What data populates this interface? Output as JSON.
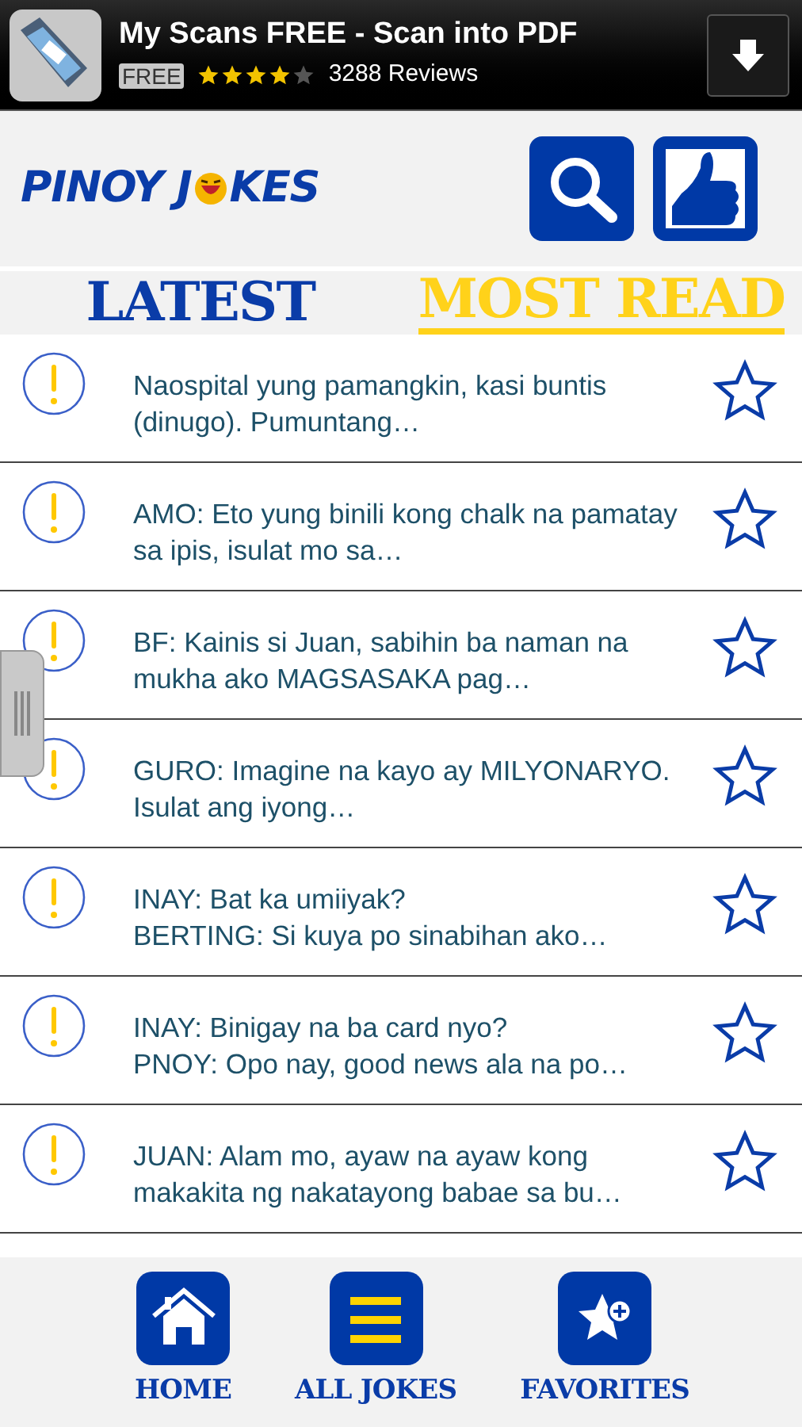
{
  "ad": {
    "title": "My Scans FREE - Scan into PDF",
    "price": "FREE",
    "stars": 4,
    "reviews": "3288 Reviews"
  },
  "logo": {
    "before": "PINOY J",
    "after": "KES"
  },
  "tabs": [
    {
      "label": "LATEST",
      "selected": false
    },
    {
      "label": "MOST READ",
      "selected": true
    }
  ],
  "jokes": [
    {
      "text": "Naospital yung pamangkin, kasi buntis (dinugo). Pumuntang…",
      "favorite": false
    },
    {
      "text": "AMO: Eto yung binili kong chalk na pamatay sa ipis, isulat mo sa…",
      "favorite": false
    },
    {
      "text": "BF: Kainis si Juan, sabihin ba naman na mukha ako MAGSASAKA pag…",
      "favorite": false
    },
    {
      "text": "GURO: Imagine na kayo ay MILYONARYO. Isulat ang iyong…",
      "favorite": false
    },
    {
      "text": "INAY: Bat ka umiiyak?\nBERTING: Si kuya po sinabihan ako…",
      "favorite": false
    },
    {
      "text": "INAY: Binigay na ba card nyo?\nPNOY: Opo nay, good news ala na po…",
      "favorite": false
    },
    {
      "text": "JUAN: Alam mo, ayaw na ayaw kong makakita ng nakatayong babae sa bu…",
      "favorite": false
    }
  ],
  "nav": [
    {
      "kind": "home",
      "label": "HOME"
    },
    {
      "kind": "list",
      "label": "ALL JOKES"
    },
    {
      "kind": "favorites",
      "label": "FAVORITES"
    }
  ]
}
